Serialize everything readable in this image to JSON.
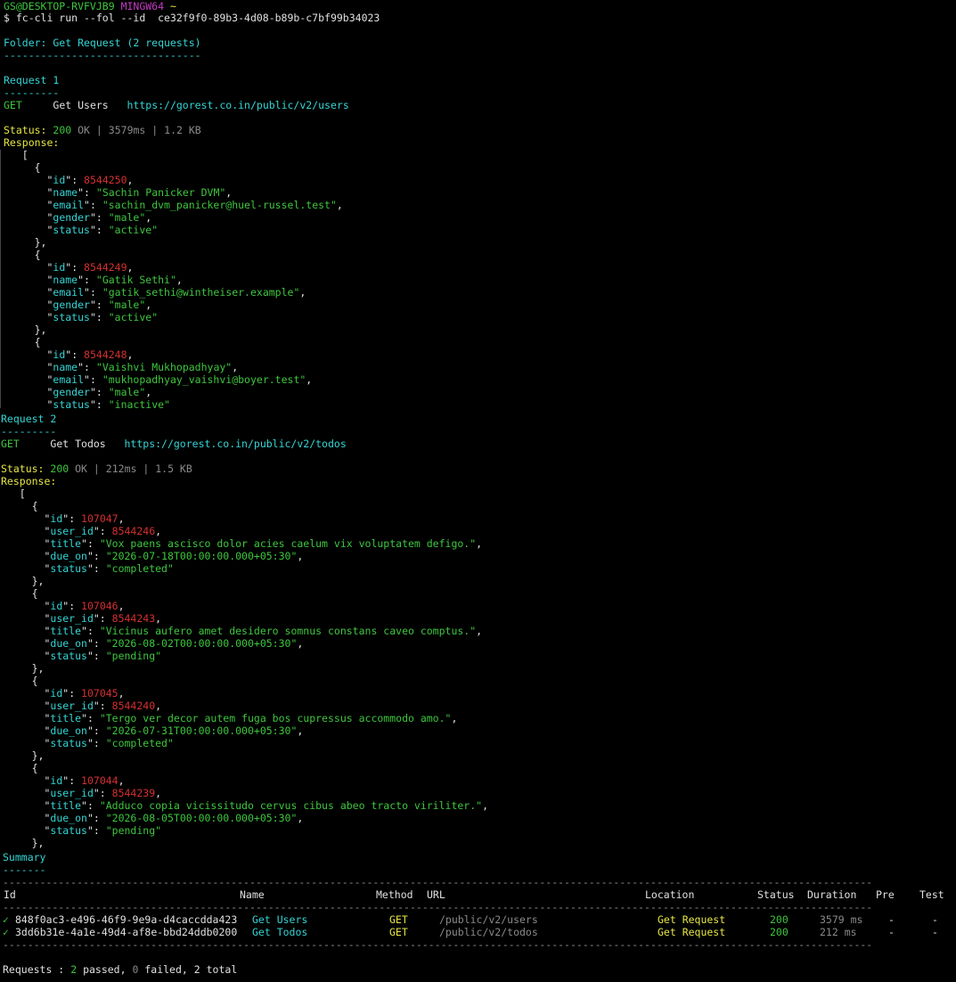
{
  "prompt": {
    "user": "GS@DESKTOP-RVFVJB9",
    "shell": "MINGW64",
    "path": "~",
    "command": "$ fc-cli run --fol --id  ce32f9f0-89b3-4d08-b89b-c7bf99b34023"
  },
  "folder": {
    "line": "Folder: Get Request (2 requests)",
    "rule": "--------------------------------"
  },
  "requests": [
    {
      "title": "Request 1",
      "rule": "---------",
      "method": "GET",
      "name": "Get Users",
      "url": "https://gorest.co.in/public/v2/users",
      "status_label": "Status:",
      "status_code": "200",
      "status_text": "OK",
      "sep": "|",
      "time": "3579ms",
      "size": "1.2 KB",
      "response_label": "Response:"
    },
    {
      "title": "Request 2",
      "rule": "---------",
      "method": "GET",
      "name": "Get Todos",
      "url": "https://gorest.co.in/public/v2/todos",
      "status_label": "Status:",
      "status_code": "200",
      "status_text": "OK",
      "sep": "|",
      "time": "212ms",
      "size": "1.5 KB",
      "response_label": "Response:"
    }
  ],
  "users": [
    {
      "id": "8544250",
      "name": "\"Sachin Panicker DVM\"",
      "email": "\"sachin_dvm_panicker@huel-russel.test\"",
      "gender": "\"male\"",
      "status": "\"active\""
    },
    {
      "id": "8544249",
      "name": "\"Gatik Sethi\"",
      "email": "\"gatik_sethi@wintheiser.example\"",
      "gender": "\"male\"",
      "status": "\"active\""
    },
    {
      "id": "8544248",
      "name": "\"Vaishvi Mukhopadhyay\"",
      "email": "\"mukhopadhyay_vaishvi@boyer.test\"",
      "gender": "\"male\"",
      "status": "\"inactive\""
    }
  ],
  "todos": [
    {
      "id": "107047",
      "user_id": "8544246",
      "title": "\"Vox paens ascisco dolor acies caelum vix voluptatem defigo.\"",
      "due_on": "\"2026-07-18T00:00:00.000+05:30\"",
      "status": "\"completed\""
    },
    {
      "id": "107046",
      "user_id": "8544243",
      "title": "\"Vicinus aufero amet desidero somnus constans caveo comptus.\"",
      "due_on": "\"2026-08-02T00:00:00.000+05:30\"",
      "status": "\"pending\""
    },
    {
      "id": "107045",
      "user_id": "8544240",
      "title": "\"Tergo ver decor autem fuga bos cupressus accommodo amo.\"",
      "due_on": "\"2026-07-31T00:00:00.000+05:30\"",
      "status": "\"completed\""
    },
    {
      "id": "107044",
      "user_id": "8544239",
      "title": "\"Adduco copia vicissitudo cervus cibus abeo tracto viriliter.\"",
      "due_on": "\"2026-08-05T00:00:00.000+05:30\"",
      "status": "\"pending\""
    }
  ],
  "summary": {
    "title": "Summary",
    "rule": "-------",
    "long_rule": "---------------------------------------------------------------------------------------------------------------------------------------------",
    "headers": {
      "id": "Id",
      "name": "Name",
      "method": "Method",
      "url": "URL",
      "location": "Location",
      "status": "Status",
      "duration": "Duration",
      "pre": "Pre",
      "test": "Test"
    },
    "rows": [
      {
        "check": "✓",
        "id": "848f0ac3-e496-46f9-9e9a-d4caccdda423",
        "name": "Get Users",
        "method": "GET",
        "url": "/public/v2/users",
        "location": "Get Request",
        "status": "200",
        "duration": "3579 ms",
        "pre": "-",
        "test": "-"
      },
      {
        "check": "✓",
        "id": "3dd6b31e-4a1e-49d4-af8e-bbd24ddb0200",
        "name": "Get Todos",
        "method": "GET",
        "url": "/public/v2/todos",
        "location": "Get Request",
        "status": "200",
        "duration": "212 ms",
        "pre": "-",
        "test": "-"
      }
    ],
    "totals": {
      "label": "Requests :",
      "passed": "2",
      "passed_label": "passed,",
      "failed": "0",
      "failed_label": "failed,",
      "total": "2",
      "total_label": "total"
    }
  }
}
